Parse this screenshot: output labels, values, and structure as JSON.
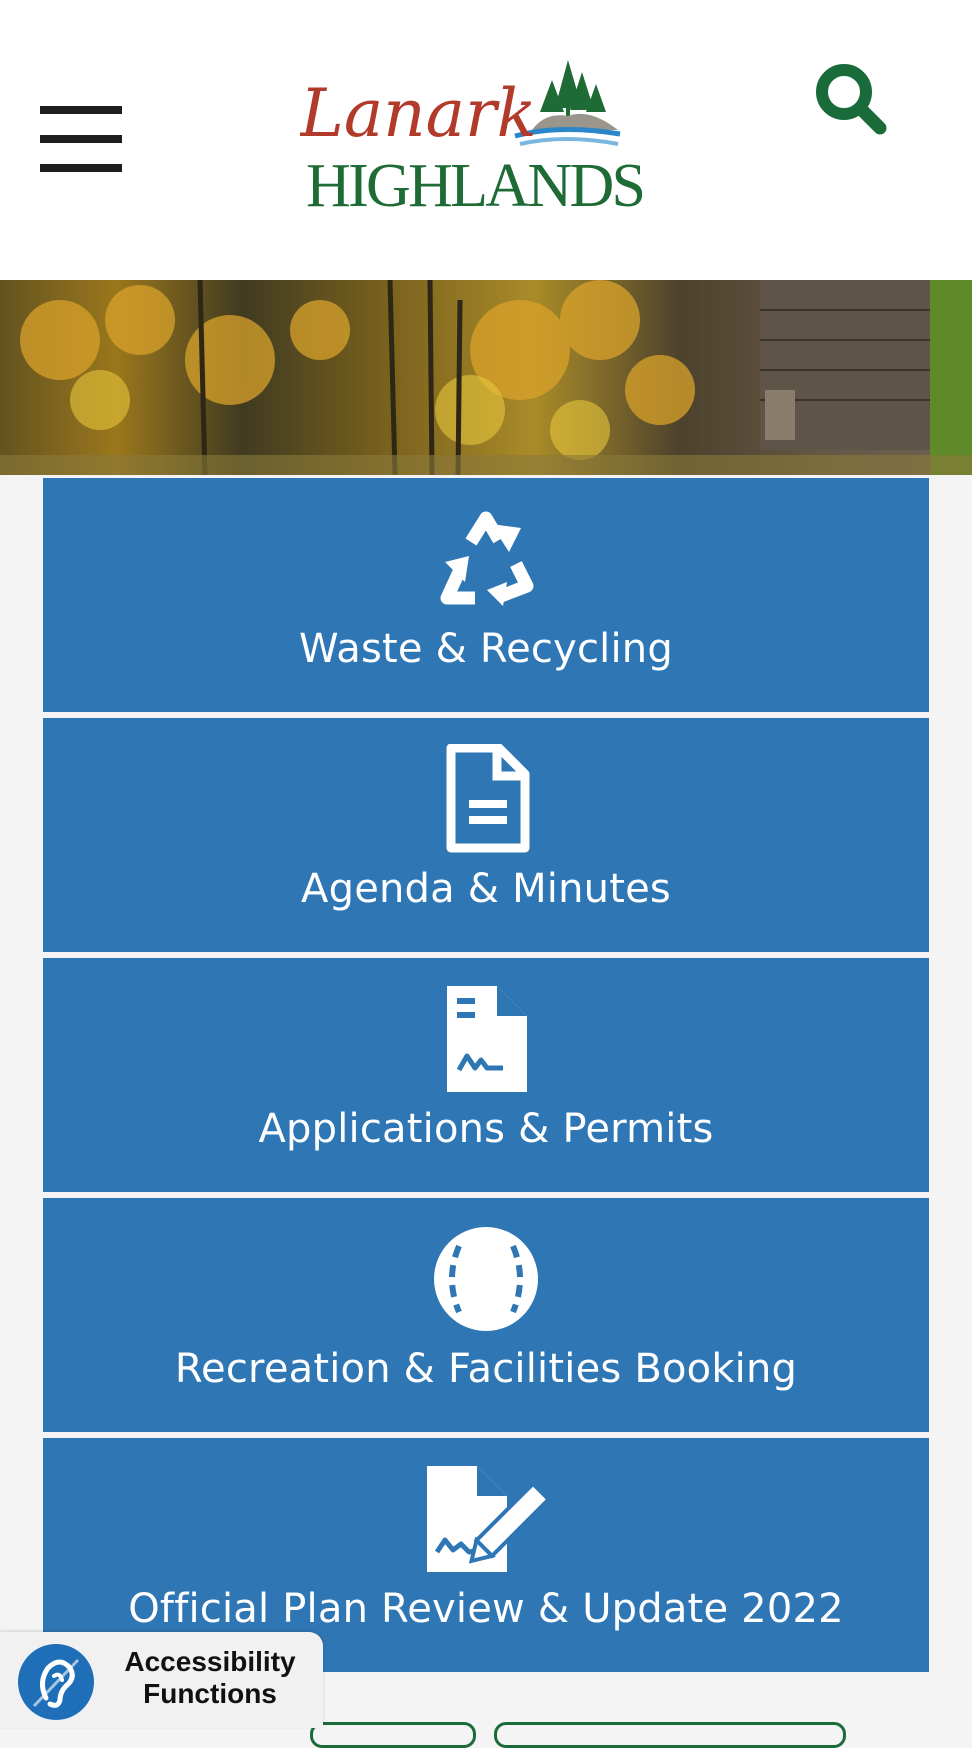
{
  "header": {
    "logo_script": "Lanark",
    "logo_main": "HIGHLANDS",
    "colors": {
      "logo_red": "#b23a2a",
      "logo_green": "#1f6b35",
      "search": "#1a6b3a"
    }
  },
  "tiles": [
    {
      "label": "Waste & Recycling",
      "icon": "recycle-icon"
    },
    {
      "label": "Agenda & Minutes",
      "icon": "document-icon"
    },
    {
      "label": "Applications & Permits",
      "icon": "signed-document-icon"
    },
    {
      "label": "Recreation & Facilities Booking",
      "icon": "baseball-icon"
    },
    {
      "label": "Official Plan Review & Update 2022",
      "icon": "document-edit-icon"
    }
  ],
  "accessibility": {
    "line1": "Accessibility",
    "line2": "Functions",
    "icon": "ear-icon"
  },
  "colors": {
    "tile_bg": "#2f76b5",
    "page_bg": "#f4f4f4"
  }
}
